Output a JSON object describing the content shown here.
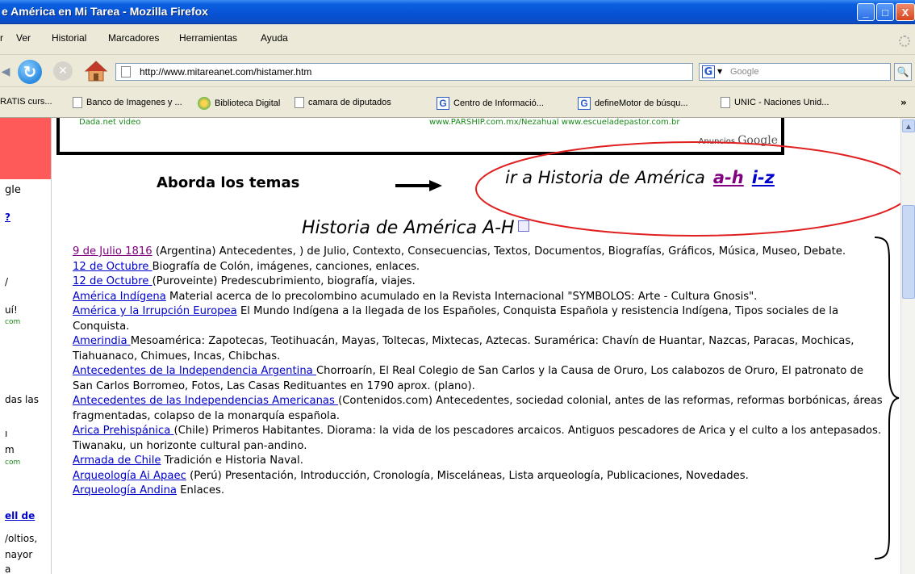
{
  "window": {
    "title": "e América en Mi Tarea - Mozilla Firefox",
    "minimize": "_",
    "maximize": "□",
    "close": "X"
  },
  "menu": [
    "r",
    "Ver",
    "Historial",
    "Marcadores",
    "Herramientas",
    "Ayuda"
  ],
  "nav": {
    "url": "http://www.mitareanet.com/histamer.htm",
    "search_placeholder": "Google",
    "search_engine": "G"
  },
  "bookmarks": [
    {
      "label": "RATIS curs...",
      "icon": "none"
    },
    {
      "label": "Banco de Imagenes y ...",
      "icon": "page-icon"
    },
    {
      "label": "Biblioteca Digital",
      "icon": "globe-icon"
    },
    {
      "label": "camara de diputados",
      "icon": "page-icon"
    },
    {
      "label": "Centro de Informació...",
      "icon": "google-icon"
    },
    {
      "label": "defineMotor de búsqu...",
      "icon": "google-icon"
    },
    {
      "label": "UNIC - Naciones Unid...",
      "icon": "page-icon"
    }
  ],
  "bookmarks_more": "»",
  "left_sidebar": {
    "google_fragment": "gle",
    "link_fragment": "?",
    "texts": [
      "/",
      "uí!",
      "com",
      "das las",
      "ı",
      "m",
      "com"
    ],
    "bold_link": "ell de",
    "bottom_texts": [
      "/oltios,",
      "nayor",
      "a"
    ]
  },
  "ad": {
    "left_text": "Dada.net video",
    "middle_text": "www.PARSHIP.com.mx/Nezahual www.escueladepastor.com.br",
    "google_prefix": "Anuncios",
    "google_brand": "Google"
  },
  "header": {
    "aborda": "Aborda los temas",
    "ir_a": "ir a Historia de América",
    "link_ah": "a-h",
    "link_iz": "i-z",
    "title": "Historia de América A-H"
  },
  "entries": [
    {
      "link": "9 de Julio 1816",
      "text": "  (Argentina) Antecedentes, ) de Julio, Contexto, Consecuencias, Textos, Documentos, Biografías, Gráficos, Música, Museo, Debate.",
      "visited": true
    },
    {
      "link": "12 de Octubre ",
      "text": "Biografía de Colón, imágenes, canciones, enlaces."
    },
    {
      "link": "12 de Octubre ",
      "text": "(Puroveinte) Predescubrimiento, biografía, viajes."
    },
    {
      "link": "América Indígena",
      "text": "  Material acerca de lo precolombino acumulado en la Revista Internacional \"SYMBOLOS: Arte - Cultura Gnosis\"."
    },
    {
      "link": "América y la Irrupción Europea",
      "text": " El Mundo Indígena a la llegada de los Españoles, Conquista Española y resistencia Indígena, Tipos sociales de la Conquista."
    },
    {
      "link": "Amerindia ",
      "text": "Mesoamérica: Zapotecas, Teotihuacán, Mayas, Toltecas, Mixtecas, Aztecas. Suramérica: Chavín de Huantar, Nazcas, Paracas, Mochicas, Tiahuanaco, Chimues, Incas, Chibchas."
    },
    {
      "link": "Antecedentes de la Independencia Argentina ",
      "text": "Chorroarín, El Real Colegio de San Carlos y la Causa de Oruro, Los calabozos de Oruro, El patronato de San Carlos Borromeo, Fotos, Las Casas Redituantes en 1790 aprox. (plano)."
    },
    {
      "link": "Antecedentes de las Independencias Americanas ",
      "text": "(Contenidos.com) Antecedentes, sociedad colonial, antes de las reformas, reformas borbónicas, áreas fragmentadas, colapso de la monarquía española."
    },
    {
      "link": "Arica Prehispánica ",
      "text": "(Chile) Primeros Habitantes. Diorama: la vida de los pescadores arcaicos. Antiguos pescadores de Arica y el culto a los antepasados. Tiwanaku, un horizonte cultural pan-andino."
    },
    {
      "link": "Armada de Chile",
      "text": " Tradición e Historia Naval."
    },
    {
      "link": "Arqueología Ai Apaec",
      "text": "  (Perú) Presentación, Introducción, Cronología, Misceláneas, Lista arqueología, Publicaciones, Novedades."
    },
    {
      "link": "Arqueología Andina",
      "text": " Enlaces."
    }
  ],
  "colors": {
    "link": "#0000cc",
    "visited": "#800080",
    "titlebar": "#0a5ee0",
    "oval": "#e02020"
  }
}
